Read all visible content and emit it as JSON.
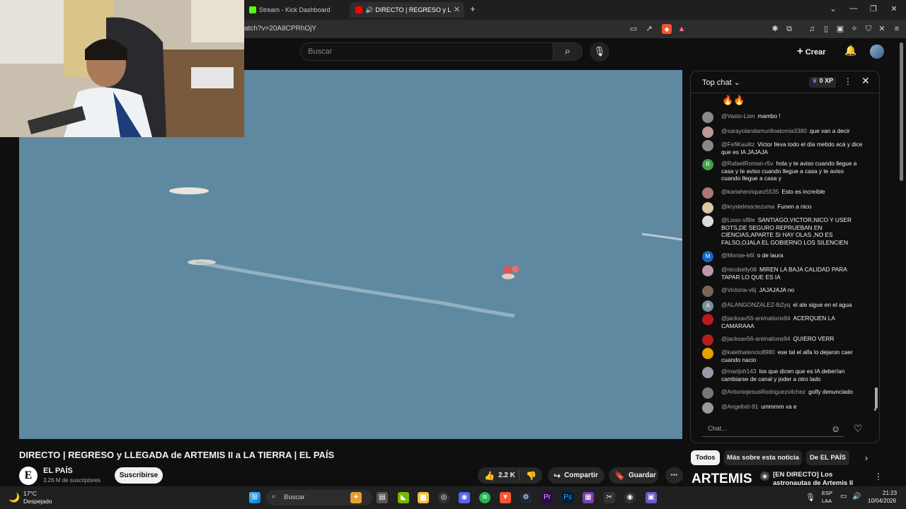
{
  "browser": {
    "tabs": [
      {
        "label": "Stream - Kick Dashboard",
        "icon": "kick-icon",
        "active": false
      },
      {
        "label": "DIRECTO | REGRESO y LLEGAD",
        "icon": "youtube-icon",
        "active": true,
        "audio": true
      }
    ],
    "url": "atch?v=20A8CPRhOjY"
  },
  "youtube": {
    "search_placeholder": "Buscar",
    "create_label": "Crear"
  },
  "video": {
    "title": "DIRECTO | REGRESO y LLEGADA de ARTEMIS II a LA TIERRA | EL PAÍS",
    "channel": "EL PAÍS",
    "channel_avatar_letter": "E",
    "subscribers": "3.26 M de suscriptores",
    "subscribe_label": "Suscribirse",
    "likes": "2.2 K",
    "share_label": "Compartir",
    "save_label": "Guardar"
  },
  "chat": {
    "title": "Top chat",
    "xp": "0 XP",
    "top_emojis": "🔥🔥",
    "messages": [
      {
        "author": "@Vasto-Lion",
        "text": "mambo !",
        "color": "#8a8a8a"
      },
      {
        "author": "@sarayolandamurilloalomia3380",
        "text": "que van a decir",
        "color": "#b99"
      },
      {
        "author": "@FefiKaulitz",
        "text": "Victor lleva todo el día metido acá y dice que es IA JAJAJA",
        "color": "#888"
      },
      {
        "author": "@RafaelRoman-r5v",
        "text": "hola y te aviso cuando llegue a casa y te aviso cuando llegue a casa y te aviso cuando llegue a casa y",
        "color": "#43a047",
        "letter": "R"
      },
      {
        "author": "@karlahenriquez5535",
        "text": "Esto es increíble",
        "color": "#a77"
      },
      {
        "author": "@krystelmoctezuma",
        "text": "Funen a nico",
        "color": "#d9c9a0"
      },
      {
        "author": "@Lisss-sf8le",
        "text": "SANTIAGO,VICTOR,NICO Y USER BOTS,DE SEGURO REPRUEBAN EN CIENCIAS,APARTE SI HAY OLAS ,NO ES FALSO,OJALA EL GOBIERNO LOS SILENCIEN",
        "color": "#ddd"
      },
      {
        "author": "@Monse-k6l",
        "text": "o de laura",
        "color": "#1565c0",
        "letter": "M"
      },
      {
        "author": "@nicobelly08",
        "text": "MIREN LA BAJA CALIDAD PARA TAPAR LO QUE ES IA",
        "color": "#b9a"
      },
      {
        "author": "@Victoria-v6j",
        "text": "JAJAJAJA no",
        "color": "#765"
      },
      {
        "author": "@ALANGONZALEZ-lb2yq",
        "text": "el ale sigue en el agua",
        "color": "#78909c",
        "letter": "A"
      },
      {
        "author": "@jacksav56-animations94",
        "text": "ACERQUEN LA CAMARAAA",
        "color": "#b71c1c"
      },
      {
        "author": "@jacksav56-animations94",
        "text": "QUIERO VERR",
        "color": "#b71c1c"
      },
      {
        "author": "@kalethatencio8980",
        "text": "ese tal el alfa lo dejaron caer cuando nacio",
        "color": "#e6a000"
      },
      {
        "author": "@marijoh143",
        "text": "los que dicen que es IA deberían cambiarse de canal y joder a otro lado",
        "color": "#99a"
      },
      {
        "author": "@AntoniojesusRodriguezvilchez",
        "text": "golfy denunciado",
        "color": "#777"
      },
      {
        "author": "@Angellxtt-91",
        "text": "ummmm va e",
        "color": "#999"
      }
    ],
    "input_placeholder": "Chat..."
  },
  "recommendations": {
    "chips": [
      {
        "label": "Todos",
        "active": true
      },
      {
        "label": "Más sobre esta noticia",
        "active": false
      },
      {
        "label": "De EL PAÍS",
        "active": false
      }
    ],
    "thumb_text": "ARTEMIS II",
    "item_title": "[EN DIRECTO] Los astronautas de Artemis II vuelven a La Tier..."
  },
  "taskbar": {
    "temperature": "17°C",
    "weather": "Despejado",
    "search_label": "Buscar",
    "lang_1": "ESP",
    "lang_2": "LAA",
    "time": "21:23",
    "date": "10/04/2026"
  }
}
